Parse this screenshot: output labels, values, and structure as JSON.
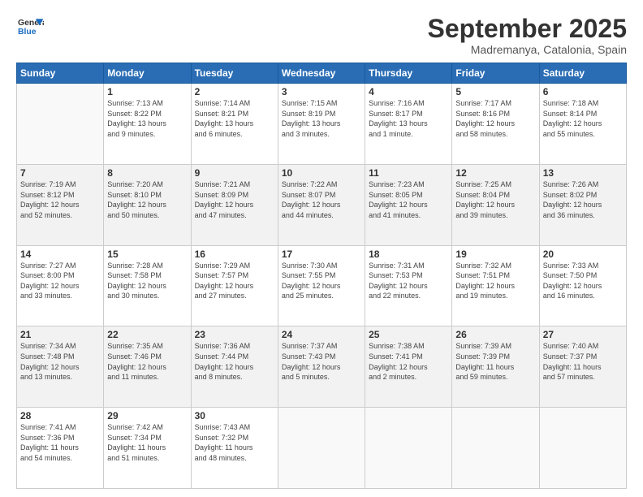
{
  "logo": {
    "line1": "General",
    "line2": "Blue"
  },
  "title": "September 2025",
  "location": "Madremanya, Catalonia, Spain",
  "headers": [
    "Sunday",
    "Monday",
    "Tuesday",
    "Wednesday",
    "Thursday",
    "Friday",
    "Saturday"
  ],
  "weeks": [
    [
      {
        "day": "",
        "info": ""
      },
      {
        "day": "1",
        "info": "Sunrise: 7:13 AM\nSunset: 8:22 PM\nDaylight: 13 hours\nand 9 minutes."
      },
      {
        "day": "2",
        "info": "Sunrise: 7:14 AM\nSunset: 8:21 PM\nDaylight: 13 hours\nand 6 minutes."
      },
      {
        "day": "3",
        "info": "Sunrise: 7:15 AM\nSunset: 8:19 PM\nDaylight: 13 hours\nand 3 minutes."
      },
      {
        "day": "4",
        "info": "Sunrise: 7:16 AM\nSunset: 8:17 PM\nDaylight: 13 hours\nand 1 minute."
      },
      {
        "day": "5",
        "info": "Sunrise: 7:17 AM\nSunset: 8:16 PM\nDaylight: 12 hours\nand 58 minutes."
      },
      {
        "day": "6",
        "info": "Sunrise: 7:18 AM\nSunset: 8:14 PM\nDaylight: 12 hours\nand 55 minutes."
      }
    ],
    [
      {
        "day": "7",
        "info": "Sunrise: 7:19 AM\nSunset: 8:12 PM\nDaylight: 12 hours\nand 52 minutes."
      },
      {
        "day": "8",
        "info": "Sunrise: 7:20 AM\nSunset: 8:10 PM\nDaylight: 12 hours\nand 50 minutes."
      },
      {
        "day": "9",
        "info": "Sunrise: 7:21 AM\nSunset: 8:09 PM\nDaylight: 12 hours\nand 47 minutes."
      },
      {
        "day": "10",
        "info": "Sunrise: 7:22 AM\nSunset: 8:07 PM\nDaylight: 12 hours\nand 44 minutes."
      },
      {
        "day": "11",
        "info": "Sunrise: 7:23 AM\nSunset: 8:05 PM\nDaylight: 12 hours\nand 41 minutes."
      },
      {
        "day": "12",
        "info": "Sunrise: 7:25 AM\nSunset: 8:04 PM\nDaylight: 12 hours\nand 39 minutes."
      },
      {
        "day": "13",
        "info": "Sunrise: 7:26 AM\nSunset: 8:02 PM\nDaylight: 12 hours\nand 36 minutes."
      }
    ],
    [
      {
        "day": "14",
        "info": "Sunrise: 7:27 AM\nSunset: 8:00 PM\nDaylight: 12 hours\nand 33 minutes."
      },
      {
        "day": "15",
        "info": "Sunrise: 7:28 AM\nSunset: 7:58 PM\nDaylight: 12 hours\nand 30 minutes."
      },
      {
        "day": "16",
        "info": "Sunrise: 7:29 AM\nSunset: 7:57 PM\nDaylight: 12 hours\nand 27 minutes."
      },
      {
        "day": "17",
        "info": "Sunrise: 7:30 AM\nSunset: 7:55 PM\nDaylight: 12 hours\nand 25 minutes."
      },
      {
        "day": "18",
        "info": "Sunrise: 7:31 AM\nSunset: 7:53 PM\nDaylight: 12 hours\nand 22 minutes."
      },
      {
        "day": "19",
        "info": "Sunrise: 7:32 AM\nSunset: 7:51 PM\nDaylight: 12 hours\nand 19 minutes."
      },
      {
        "day": "20",
        "info": "Sunrise: 7:33 AM\nSunset: 7:50 PM\nDaylight: 12 hours\nand 16 minutes."
      }
    ],
    [
      {
        "day": "21",
        "info": "Sunrise: 7:34 AM\nSunset: 7:48 PM\nDaylight: 12 hours\nand 13 minutes."
      },
      {
        "day": "22",
        "info": "Sunrise: 7:35 AM\nSunset: 7:46 PM\nDaylight: 12 hours\nand 11 minutes."
      },
      {
        "day": "23",
        "info": "Sunrise: 7:36 AM\nSunset: 7:44 PM\nDaylight: 12 hours\nand 8 minutes."
      },
      {
        "day": "24",
        "info": "Sunrise: 7:37 AM\nSunset: 7:43 PM\nDaylight: 12 hours\nand 5 minutes."
      },
      {
        "day": "25",
        "info": "Sunrise: 7:38 AM\nSunset: 7:41 PM\nDaylight: 12 hours\nand 2 minutes."
      },
      {
        "day": "26",
        "info": "Sunrise: 7:39 AM\nSunset: 7:39 PM\nDaylight: 11 hours\nand 59 minutes."
      },
      {
        "day": "27",
        "info": "Sunrise: 7:40 AM\nSunset: 7:37 PM\nDaylight: 11 hours\nand 57 minutes."
      }
    ],
    [
      {
        "day": "28",
        "info": "Sunrise: 7:41 AM\nSunset: 7:36 PM\nDaylight: 11 hours\nand 54 minutes."
      },
      {
        "day": "29",
        "info": "Sunrise: 7:42 AM\nSunset: 7:34 PM\nDaylight: 11 hours\nand 51 minutes."
      },
      {
        "day": "30",
        "info": "Sunrise: 7:43 AM\nSunset: 7:32 PM\nDaylight: 11 hours\nand 48 minutes."
      },
      {
        "day": "",
        "info": ""
      },
      {
        "day": "",
        "info": ""
      },
      {
        "day": "",
        "info": ""
      },
      {
        "day": "",
        "info": ""
      }
    ]
  ]
}
